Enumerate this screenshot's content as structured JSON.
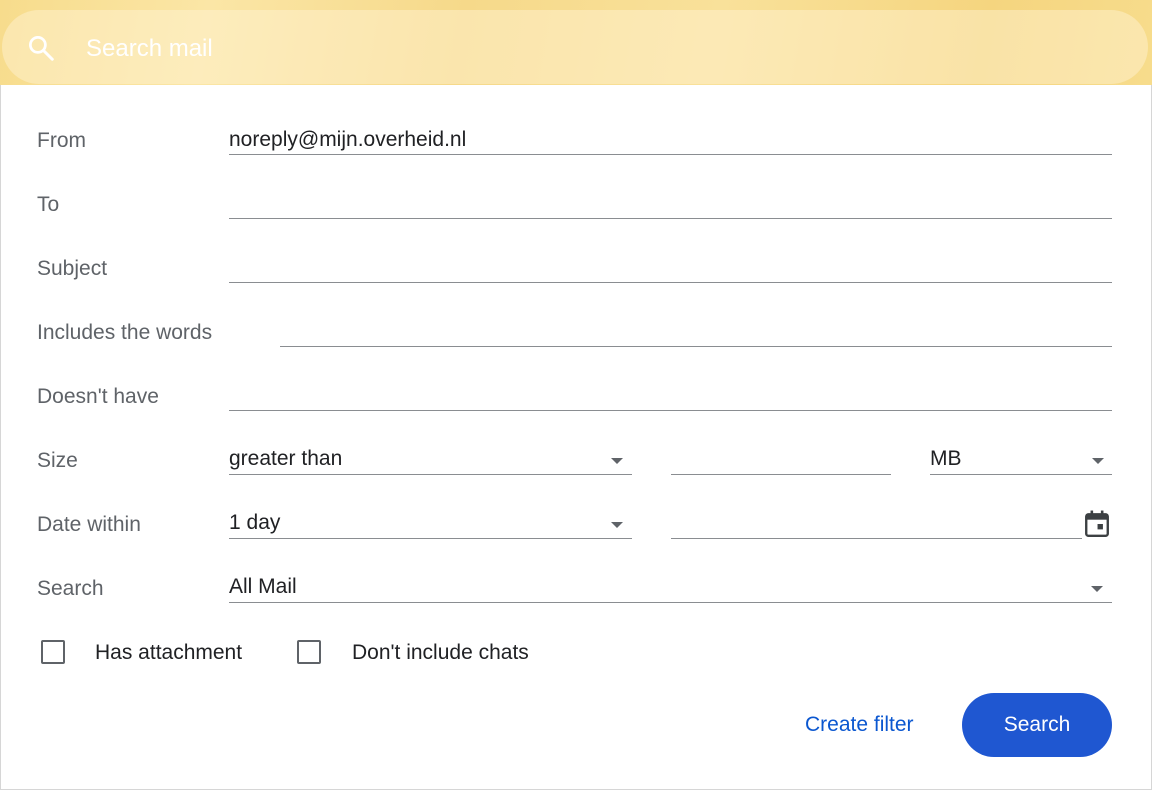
{
  "search": {
    "placeholder": "Search mail"
  },
  "form": {
    "from": {
      "label": "From",
      "value": "noreply@mijn.overheid.nl"
    },
    "to": {
      "label": "To",
      "value": ""
    },
    "subject": {
      "label": "Subject",
      "value": ""
    },
    "includes": {
      "label": "Includes the words",
      "value": ""
    },
    "doesnt_have": {
      "label": "Doesn't have",
      "value": ""
    },
    "size": {
      "label": "Size",
      "comparator": "greater than",
      "amount": "",
      "unit": "MB"
    },
    "date_within": {
      "label": "Date within",
      "range": "1 day",
      "date": ""
    },
    "search_in": {
      "label": "Search",
      "value": "All Mail"
    },
    "has_attachment": {
      "label": "Has attachment",
      "checked": false
    },
    "no_chats": {
      "label": "Don't include chats",
      "checked": false
    }
  },
  "actions": {
    "create_filter": "Create filter",
    "search": "Search"
  },
  "colors": {
    "accent": "#0b57d0",
    "button": "#1f57d1",
    "header": "#f7dc8c"
  },
  "icons": {
    "search": "search-icon",
    "calendar": "calendar-icon",
    "dropdown": "arrow-drop-down-icon"
  }
}
